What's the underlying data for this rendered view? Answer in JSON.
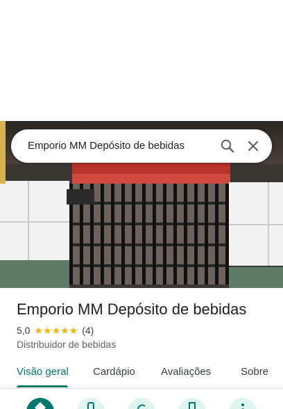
{
  "search": {
    "query": "Emporio MM Depósito de bebidas",
    "search_icon": "search-icon",
    "close_icon": "close-icon"
  },
  "photo": {
    "subject": "storefront-photo"
  },
  "place": {
    "name": "Emporio MM Depósito de bebidas",
    "rating": "5,0",
    "stars": "★★★★★",
    "reviews_count": "(4)",
    "category": "Distribuidor de bebidas"
  },
  "tabs": [
    {
      "label": "Visão geral",
      "active": true
    },
    {
      "label": "Cardápio",
      "active": false
    },
    {
      "label": "Avaliações",
      "active": false
    },
    {
      "label": "Sobre",
      "active": false
    }
  ],
  "actions": [
    {
      "icon": "directions-icon"
    },
    {
      "icon": "phone-icon"
    },
    {
      "icon": "share-icon"
    },
    {
      "icon": "save-icon"
    },
    {
      "icon": "more-icon"
    }
  ],
  "colors": {
    "accent": "#00796b",
    "star": "#f4b400",
    "action_bg": "#dff3ef"
  }
}
